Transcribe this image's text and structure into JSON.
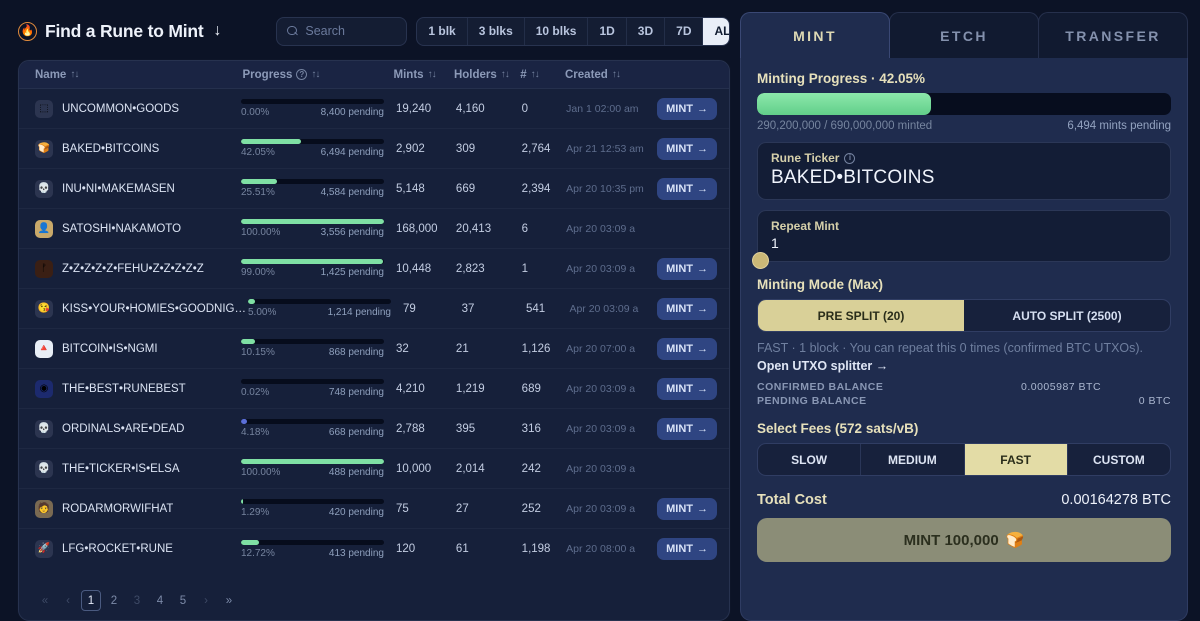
{
  "header": {
    "title": "Find a Rune to Mint",
    "title_arrow": "↓",
    "flame_icon": "flame-icon",
    "search_placeholder": "Search",
    "search_value": "",
    "filters": [
      {
        "label": "1 blk",
        "active": false
      },
      {
        "label": "3 blks",
        "active": false
      },
      {
        "label": "10 blks",
        "active": false
      },
      {
        "label": "1D",
        "active": false
      },
      {
        "label": "3D",
        "active": false
      },
      {
        "label": "7D",
        "active": false
      },
      {
        "label": "ALL",
        "active": true
      }
    ]
  },
  "table": {
    "columns": [
      {
        "label": "Name",
        "sort": "↑↓"
      },
      {
        "label": "Progress",
        "sort": "↑↓",
        "help": true
      },
      {
        "label": "Mints",
        "sort": "↑↓"
      },
      {
        "label": "Holders",
        "sort": "↑↓"
      },
      {
        "label": "#",
        "sort": "↑↓"
      },
      {
        "label": "Created",
        "sort": "↑↓"
      }
    ],
    "rows": [
      {
        "avatar": "⬚",
        "avatar_bg": "#2c3550",
        "name": "UNCOMMON•GOODS",
        "pct": "0.00%",
        "pct_num": 0.0,
        "pending": "8,400 pending",
        "mints": "19,240",
        "holders": "4,160",
        "num": "0",
        "created": "Jan 1 02:00 am",
        "mint": "MINT",
        "has_mint": true,
        "bar_color": "#7fe0a4"
      },
      {
        "avatar": "🍞",
        "avatar_bg": "#2c3550",
        "name": "BAKED•BITCOINS",
        "pct": "42.05%",
        "pct_num": 42.05,
        "pending": "6,494 pending",
        "mints": "2,902",
        "holders": "309",
        "num": "2,764",
        "created": "Apr 21 12:53 am",
        "mint": "MINT",
        "has_mint": true,
        "bar_color": "#7fe0a4"
      },
      {
        "avatar": "💀",
        "avatar_bg": "#2c3550",
        "name": "INU•NI•MAKEMASEN",
        "pct": "25.51%",
        "pct_num": 25.51,
        "pending": "4,584 pending",
        "mints": "5,148",
        "holders": "669",
        "num": "2,394",
        "created": "Apr 20 10:35 pm",
        "mint": "MINT",
        "has_mint": true,
        "bar_color": "#7fe0a4"
      },
      {
        "avatar": "👤",
        "avatar_bg": "#c9a96a",
        "name": "SATOSHI•NAKAMOTO",
        "pct": "100.00%",
        "pct_num": 100.0,
        "pending": "3,556 pending",
        "mints": "168,000",
        "holders": "20,413",
        "num": "6",
        "created": "Apr 20 03:09 a",
        "mint": "",
        "has_mint": false,
        "bar_color": "#7fe0a4"
      },
      {
        "avatar": "ᚠ",
        "avatar_bg": "#3a1f14",
        "name": "Z•Z•Z•Z•Z•FEHU•Z•Z•Z•Z•Z",
        "pct": "99.00%",
        "pct_num": 99.0,
        "pending": "1,425 pending",
        "mints": "10,448",
        "holders": "2,823",
        "num": "1",
        "created": "Apr 20 03:09 a",
        "mint": "MINT",
        "has_mint": true,
        "bar_color": "#7fe0a4"
      },
      {
        "avatar": "😘",
        "avatar_bg": "#2c3550",
        "name": "KISS•YOUR•HOMIES•GOODNIGHT",
        "pct": "5.00%",
        "pct_num": 5.0,
        "pending": "1,214 pending",
        "mints": "79",
        "holders": "37",
        "num": "541",
        "created": "Apr 20 03:09 a",
        "mint": "MINT",
        "has_mint": true,
        "bar_color": "#7fe0a4"
      },
      {
        "avatar": "🔺",
        "avatar_bg": "#e8eef6",
        "name": "BITCOIN•IS•NGMI",
        "pct": "10.15%",
        "pct_num": 10.15,
        "pending": "868 pending",
        "mints": "32",
        "holders": "21",
        "num": "1,126",
        "created": "Apr 20 07:00 a",
        "mint": "MINT",
        "has_mint": true,
        "bar_color": "#7fe0a4"
      },
      {
        "avatar": "◉",
        "avatar_bg": "#1c2a6e",
        "name": "THE•BEST•RUNEBEST",
        "pct": "0.02%",
        "pct_num": 0.02,
        "pending": "748 pending",
        "mints": "4,210",
        "holders": "1,219",
        "num": "689",
        "created": "Apr 20 03:09 a",
        "mint": "MINT",
        "has_mint": true,
        "bar_color": "#7fe0a4"
      },
      {
        "avatar": "💀",
        "avatar_bg": "#2c3550",
        "name": "ORDINALS•ARE•DEAD",
        "pct": "4.18%",
        "pct_num": 4.18,
        "pending": "668 pending",
        "mints": "2,788",
        "holders": "395",
        "num": "316",
        "created": "Apr 20 03:09 a",
        "mint": "MINT",
        "has_mint": true,
        "bar_color": "#5b6fd8"
      },
      {
        "avatar": "💀",
        "avatar_bg": "#2c3550",
        "name": "THE•TICKER•IS•ELSA",
        "pct": "100.00%",
        "pct_num": 100.0,
        "pending": "488 pending",
        "mints": "10,000",
        "holders": "2,014",
        "num": "242",
        "created": "Apr 20 03:09 a",
        "mint": "",
        "has_mint": false,
        "bar_color": "#7fe0a4"
      },
      {
        "avatar": "🧑",
        "avatar_bg": "#7a6a52",
        "name": "RODARMORWIFHAT",
        "pct": "1.29%",
        "pct_num": 1.29,
        "pending": "420 pending",
        "mints": "75",
        "holders": "27",
        "num": "252",
        "created": "Apr 20 03:09 a",
        "mint": "MINT",
        "has_mint": true,
        "bar_color": "#7fe0a4"
      },
      {
        "avatar": "🚀",
        "avatar_bg": "#2c3550",
        "name": "LFG•ROCKET•RUNE",
        "pct": "12.72%",
        "pct_num": 12.72,
        "pending": "413 pending",
        "mints": "120",
        "holders": "61",
        "num": "1,198",
        "created": "Apr 20 08:00 a",
        "mint": "MINT",
        "has_mint": true,
        "bar_color": "#7fe0a4"
      }
    ],
    "pagination": {
      "first": "«",
      "prev": "‹",
      "pages": [
        "1",
        "2",
        "3",
        "4",
        "5"
      ],
      "current": "1",
      "next": "›",
      "last": "»"
    }
  },
  "panel": {
    "tabs": [
      {
        "label": "MINT",
        "active": true
      },
      {
        "label": "ETCH",
        "active": false
      },
      {
        "label": "TRANSFER",
        "active": false
      }
    ],
    "progress": {
      "title": "Minting Progress · 42.05%",
      "percent": 42.05,
      "minted": "290,200,000 / 690,000,000 minted",
      "pending": "6,494 mints pending"
    },
    "ticker": {
      "label": "Rune Ticker",
      "info_icon": "info-icon",
      "value": "BAKED•BITCOINS"
    },
    "repeat": {
      "label": "Repeat Mint",
      "value": "1"
    },
    "minting_mode": {
      "title": "Minting Mode (Max)",
      "options": [
        {
          "label": "PRE SPLIT (20)",
          "active": true
        },
        {
          "label": "AUTO SPLIT (2500)",
          "active": false
        }
      ],
      "note_prefix": "FAST · 1 block · You can repeat this 0 times (confirmed BTC UTXOs). ",
      "note_link": "Open UTXO splitter →"
    },
    "balances": [
      {
        "label": "CONFIRMED BALANCE",
        "value": "0.0005987 BTC"
      },
      {
        "label": "PENDING BALANCE",
        "value": "0 BTC"
      }
    ],
    "fees": {
      "title": "Select Fees (572 sats/vB)",
      "options": [
        {
          "label": "SLOW",
          "active": false
        },
        {
          "label": "MEDIUM",
          "active": false
        },
        {
          "label": "FAST",
          "active": true
        },
        {
          "label": "CUSTOM",
          "active": false
        }
      ]
    },
    "total": {
      "label": "Total Cost",
      "value": "0.00164278 BTC"
    },
    "cta": {
      "label": "MINT 100,000",
      "icon": "bread-icon"
    }
  }
}
